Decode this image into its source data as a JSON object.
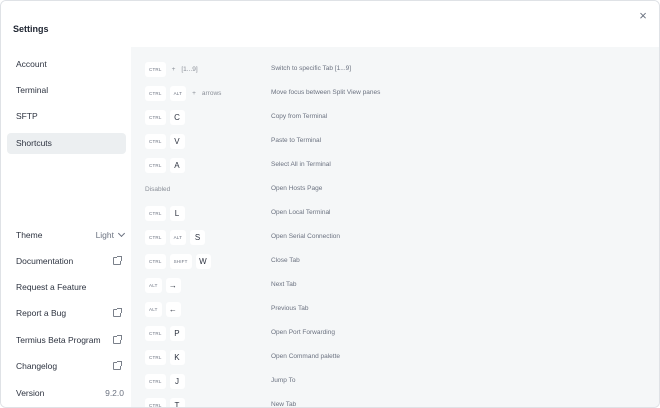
{
  "window": {
    "title": "Settings",
    "close_glyph": "×"
  },
  "sidebar": {
    "nav": [
      {
        "label": "Account"
      },
      {
        "label": "Terminal"
      },
      {
        "label": "SFTP"
      },
      {
        "label": "Shortcuts",
        "active": true
      }
    ],
    "theme": {
      "label": "Theme",
      "value": "Light"
    },
    "links": [
      {
        "label": "Documentation",
        "external": true
      },
      {
        "label": "Request a Feature",
        "external": false
      },
      {
        "label": "Report a Bug",
        "external": true
      },
      {
        "label": "Termius Beta Program",
        "external": true
      },
      {
        "label": "Changelog",
        "external": true
      }
    ],
    "version": {
      "label": "Version",
      "value": "9.2.0"
    }
  },
  "shortcuts": [
    {
      "keys": [
        "CTRL"
      ],
      "extra": "+",
      "text": "[1...9]",
      "description": "Switch to specific Tab [1...9]"
    },
    {
      "keys": [
        "CTRL",
        "ALT"
      ],
      "extra": "+",
      "text": "arrows",
      "description": "Move focus between Split View panes"
    },
    {
      "keys": [
        "CTRL",
        "C"
      ],
      "description": "Copy from Terminal"
    },
    {
      "keys": [
        "CTRL",
        "V"
      ],
      "description": "Paste to Terminal"
    },
    {
      "keys": [
        "CTRL",
        "A"
      ],
      "description": "Select All in Terminal"
    },
    {
      "plain": "Disabled",
      "description": "Open Hosts Page"
    },
    {
      "keys": [
        "CTRL",
        "L"
      ],
      "description": "Open Local Terminal"
    },
    {
      "keys": [
        "CTRL",
        "ALT",
        "S"
      ],
      "description": "Open Serial Connection"
    },
    {
      "keys": [
        "CTRL",
        "SHIFT",
        "W"
      ],
      "description": "Close Tab"
    },
    {
      "keys": [
        "ALT",
        "→"
      ],
      "description": "Next Tab"
    },
    {
      "keys": [
        "ALT",
        "←"
      ],
      "description": "Previous Tab"
    },
    {
      "keys": [
        "CTRL",
        "P"
      ],
      "description": "Open Port Forwarding"
    },
    {
      "keys": [
        "CTRL",
        "K"
      ],
      "description": "Open Command palette"
    },
    {
      "keys": [
        "CTRL",
        "J"
      ],
      "description": "Jump To"
    },
    {
      "keys": [
        "CTRL",
        "T"
      ],
      "description": "New Tab"
    }
  ]
}
